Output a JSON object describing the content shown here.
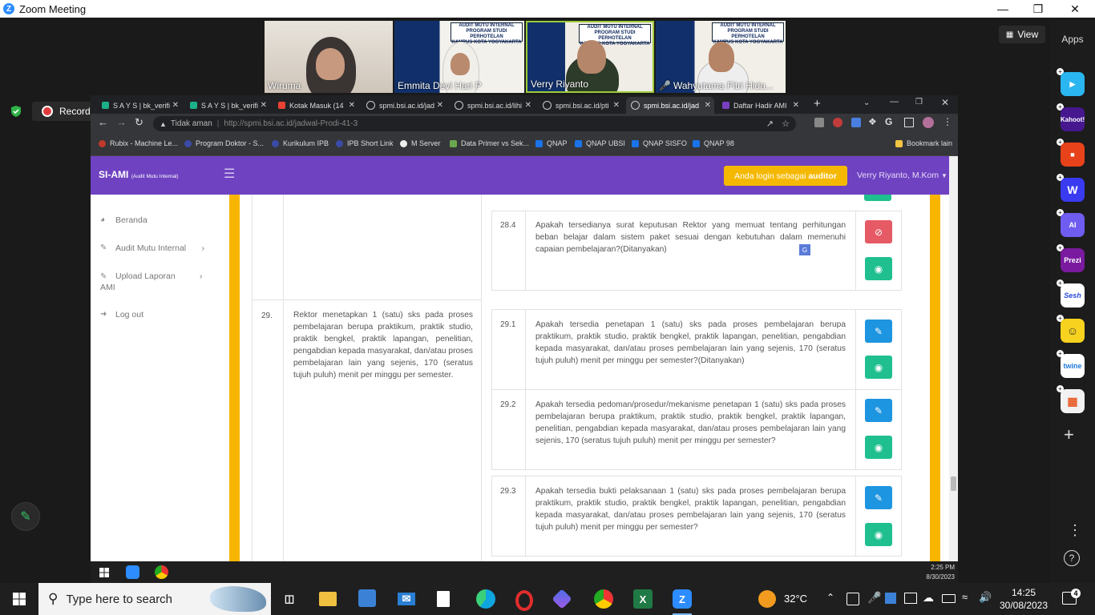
{
  "zoom": {
    "window_title": "Zoom Meeting",
    "view_label": "View",
    "apps_label": "Apps",
    "recording_label": "Recording...",
    "participants": [
      {
        "name": "Wiruma"
      },
      {
        "name": "Emmita Devi Hari P"
      },
      {
        "name": "Verry Riyanto"
      },
      {
        "name": "Wahyutama Fitri Hida..."
      }
    ],
    "banner_lines": [
      "AUDIT MUTU INTERNAL",
      "PROGRAM STUDI PERHOTELAN",
      "KAMPUS KOTA YOGYAKARTA"
    ],
    "apps": [
      "Kahoot!",
      "Prezi",
      "Sesh",
      "twine"
    ]
  },
  "browser": {
    "tabs": [
      {
        "label": "S A Y S | bk_verifi"
      },
      {
        "label": "S A Y S | bk_verifi"
      },
      {
        "label": "Kotak Masuk (14"
      },
      {
        "label": "spmi.bsi.ac.id/jad"
      },
      {
        "label": "spmi.bsi.ac.id/lihi"
      },
      {
        "label": "spmi.bsi.ac.id/pti"
      },
      {
        "label": "spmi.bsi.ac.id/jad"
      },
      {
        "label": "Daftar Hadir AMI"
      }
    ],
    "security_label": "Tidak aman",
    "url": "http://spmi.bsi.ac.id/jadwal-Prodi-41-3",
    "bookmarks": [
      {
        "label": "Rubix - Machine Le..."
      },
      {
        "label": "Program Doktor - S..."
      },
      {
        "label": "Kurikulum IPB"
      },
      {
        "label": "IPB Short Link"
      },
      {
        "label": "M Server"
      },
      {
        "label": "Data Primer vs Sek..."
      },
      {
        "label": "QNAP"
      },
      {
        "label": "QNAP UBSI"
      },
      {
        "label": "QNAP SISFO"
      },
      {
        "label": "QNAP 98"
      }
    ],
    "bookmark_other": "Bookmark lain"
  },
  "app": {
    "brand": "SI-AMI",
    "brand_sub": "(Audit Mutu Internal)",
    "login_prefix": "Anda login sebagai ",
    "login_role": "auditor",
    "user": "Verry Riyanto, M.Kom",
    "menu": [
      {
        "label": "Beranda"
      },
      {
        "label": "Audit Mutu Internal"
      },
      {
        "label": "Upload Laporan AMI"
      },
      {
        "label": "Log out"
      }
    ],
    "rows": [
      {
        "no": "29.",
        "standard": "Rektor menetapkan 1 (satu) sks pada proses pembelajaran berupa praktikum, praktik studio, praktik bengkel, praktik lapangan, penelitian, pengabdian kepada masyarakat, dan/atau proses pembelajaran lain yang sejenis, 170 (seratus tujuh puluh) menit per minggu per semester."
      }
    ],
    "questions": [
      {
        "no": "28.4",
        "text": "Apakah tersedianya surat keputusan Rektor yang memuat tentang perhitungan beban belajar dalam sistem paket sesuai dengan kebutuhan dalam memenuhi capaian pembelajaran?(Ditanyakan)"
      },
      {
        "no": "29.1",
        "text": "Apakah tersedia penetapan 1 (satu) sks pada proses pembelajaran berupa praktikum, praktik studio, praktik bengkel, praktik lapangan, penelitian, pengabdian kepada masyarakat, dan/atau proses pembelajaran lain yang sejenis, 170 (seratus tujuh puluh) menit per minggu per semester?(Ditanyakan)"
      },
      {
        "no": "29.2",
        "text": "Apakah tersedia pedoman/prosedur/mekanisme penetapan 1 (satu) sks pada proses pembelajaran berupa praktikum, praktik studio, praktik bengkel, praktik lapangan, penelitian, pengabdian kepada masyarakat, dan/atau proses pembelajaran lain yang sejenis, 170 (seratus tujuh puluh) menit per minggu per semester?"
      },
      {
        "no": "29.3",
        "text": "Apakah tersedia bukti pelaksanaan 1 (satu) sks pada proses pembelajaran berupa praktikum, praktik studio, praktik bengkel, praktik lapangan, penelitian, pengabdian kepada masyarakat, dan/atau proses pembelajaran lain yang sejenis, 170 (seratus tujuh puluh) menit per minggu per semester?"
      }
    ]
  },
  "inner_taskbar": {
    "time": "2:25 PM",
    "date": "8/30/2023"
  },
  "taskbar": {
    "search_placeholder": "Type here to search",
    "temperature": "32°C",
    "time": "14:25",
    "date": "30/08/2023",
    "notifications": "4"
  }
}
